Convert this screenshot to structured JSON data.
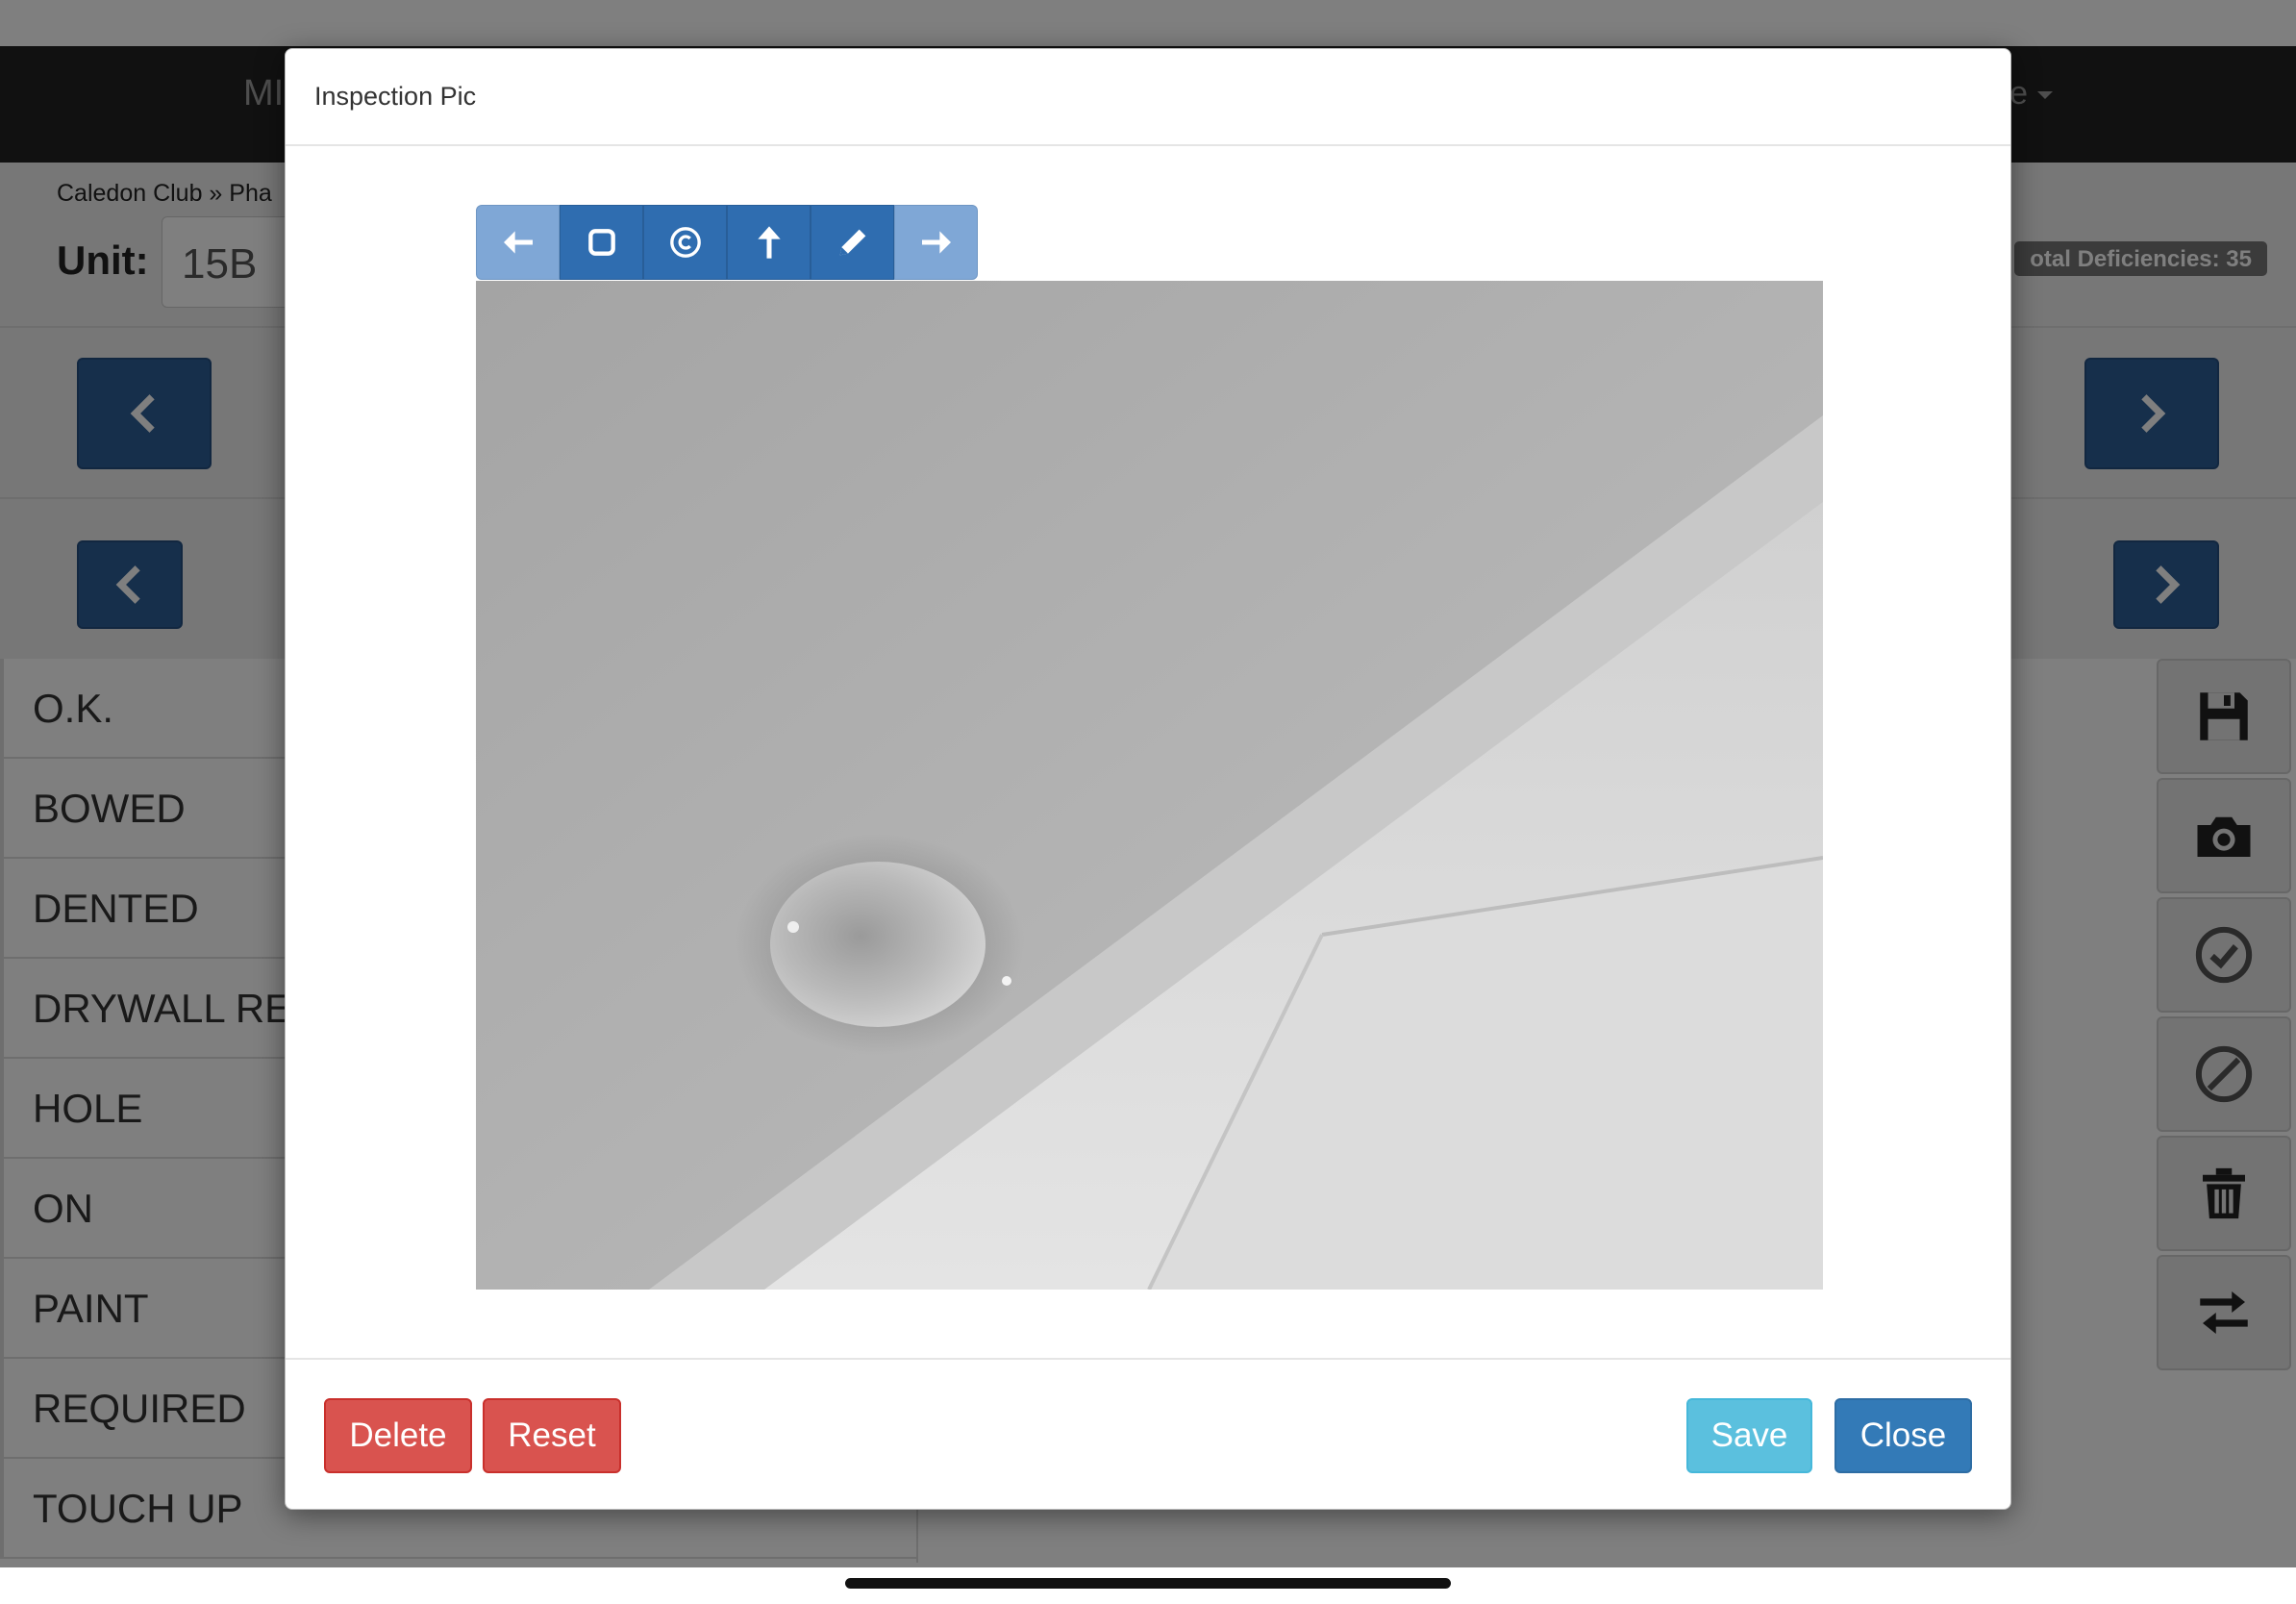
{
  "app": {
    "brand": "MI",
    "user_menu": "e",
    "breadcrumb": "Caledon Club » Pha",
    "unit_label": "Unit:",
    "unit_value": "15B",
    "total_deficiencies": "otal Deficiencies: 35"
  },
  "deficiency_list": {
    "items": [
      "O.K.",
      "BOWED",
      "DENTED",
      "DRYWALL RE",
      "HOLE",
      "ON",
      "PAINT",
      "REQUIRED",
      "TOUCH UP"
    ]
  },
  "side_tools": {
    "icons": [
      "save-icon",
      "camera-icon",
      "check-circle-icon",
      "ban-icon",
      "trash-icon",
      "swap-icon"
    ]
  },
  "modal": {
    "title": "Inspection Pic",
    "toolbar_icons": [
      "undo-arrow-icon",
      "rectangle-icon",
      "circle-icon",
      "up-arrow-icon",
      "pencil-icon",
      "redo-arrow-icon"
    ],
    "buttons": {
      "delete": "Delete",
      "reset": "Reset",
      "save": "Save",
      "close": "Close"
    }
  },
  "colors": {
    "primary": "#337ab7",
    "danger": "#d9534f",
    "info": "#5bc0de",
    "nav_button": "#2c5f97",
    "toolbar_active": "#2f6db0",
    "toolbar_disabled": "#7fa7d6"
  }
}
